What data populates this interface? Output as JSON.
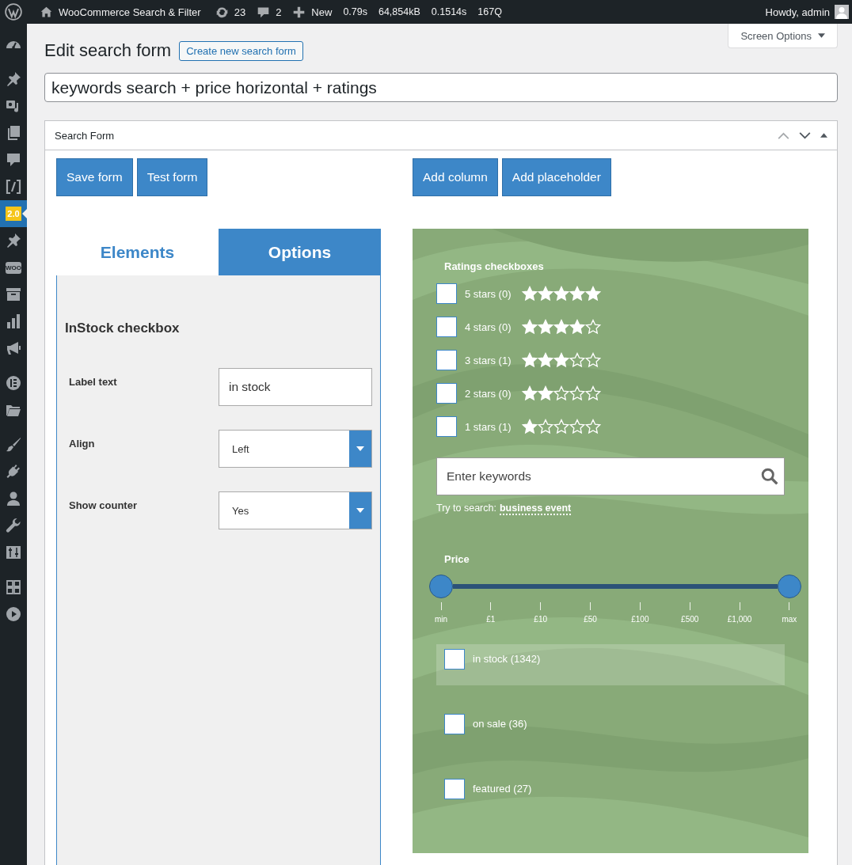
{
  "admin_bar": {
    "items": [
      {
        "kind": "wp"
      },
      {
        "kind": "home",
        "label": "WooCommerce Search & Filter"
      },
      {
        "kind": "updates",
        "label": "23"
      },
      {
        "kind": "comments",
        "label": "2"
      },
      {
        "kind": "new",
        "label": "New"
      },
      {
        "kind": "stat",
        "label": "0.79s"
      },
      {
        "kind": "stat",
        "label": "64,854kB"
      },
      {
        "kind": "stat",
        "label": "0.1514s"
      },
      {
        "kind": "stat",
        "label": "167Q"
      }
    ],
    "greeting": "Howdy, admin"
  },
  "sidebar": {
    "groups": [
      [
        {
          "kind": "dashboard",
          "selected": false
        }
      ],
      [
        {
          "kind": "pin",
          "selected": false
        },
        {
          "kind": "media",
          "selected": false
        },
        {
          "kind": "pages",
          "selected": false
        },
        {
          "kind": "comment",
          "selected": false
        },
        {
          "kind": "code",
          "selected": false
        },
        {
          "kind": "badge",
          "text": "2.0",
          "selected": true
        },
        {
          "kind": "pin",
          "selected": false
        },
        {
          "kind": "woo",
          "text": "WOO",
          "selected": false
        },
        {
          "kind": "archive",
          "selected": false
        },
        {
          "kind": "chart",
          "selected": false
        },
        {
          "kind": "megaphone",
          "selected": false
        }
      ],
      [
        {
          "kind": "circle",
          "selected": false
        },
        {
          "kind": "folder",
          "selected": false
        }
      ],
      [
        {
          "kind": "brush",
          "selected": false
        },
        {
          "kind": "plug",
          "selected": false
        },
        {
          "kind": "user",
          "selected": false
        },
        {
          "kind": "wrench",
          "selected": false
        },
        {
          "kind": "sliders",
          "selected": false
        }
      ],
      [
        {
          "kind": "grid",
          "selected": false
        },
        {
          "kind": "play",
          "selected": false
        }
      ]
    ]
  },
  "screen_options": "Screen Options",
  "page_title": "Edit search form",
  "new_button": "Create new search form",
  "form_title": "keywords search + price horizontal + ratings",
  "postbox": {
    "title": "Search Form",
    "left_buttons": [
      "Save form",
      "Test form"
    ],
    "right_buttons": [
      "Add column",
      "Add placeholder"
    ],
    "tabs": [
      {
        "label": "Elements",
        "selected": false
      },
      {
        "label": "Options",
        "selected": true
      }
    ],
    "options": {
      "heading": "InStock checkbox",
      "fields": [
        {
          "kind": "text",
          "label": "Label text",
          "value": "in stock"
        },
        {
          "kind": "select",
          "label": "Align",
          "value": "Left"
        },
        {
          "kind": "select",
          "label": "Show counter",
          "value": "Yes"
        }
      ]
    },
    "preview": {
      "ratings": {
        "title": "Ratings checkboxes",
        "options": [
          {
            "label": "5 stars (0)",
            "checked": false,
            "stars": 5
          },
          {
            "label": "4 stars (0)",
            "checked": false,
            "stars": 4
          },
          {
            "label": "3 stars (1)",
            "checked": false,
            "stars": 3
          },
          {
            "label": "2 stars (0)",
            "checked": false,
            "stars": 2
          },
          {
            "label": "1 stars (1)",
            "checked": false,
            "stars": 1
          }
        ]
      },
      "search": {
        "placeholder": "Enter keywords",
        "hint": "Try to search:",
        "suggestion": "business event"
      },
      "price": {
        "title": "Price",
        "level": 1,
        "ticks": [
          "min",
          "£1",
          "£10",
          "£50",
          "£100",
          "£500",
          "£1,000",
          "max"
        ]
      },
      "checkboxes": [
        {
          "label": "in stock (1342)",
          "checked": false,
          "selected": true
        },
        {
          "label": "on sale (36)",
          "checked": false,
          "selected": false
        },
        {
          "label": "featured (27)",
          "checked": false,
          "selected": false
        }
      ]
    }
  }
}
